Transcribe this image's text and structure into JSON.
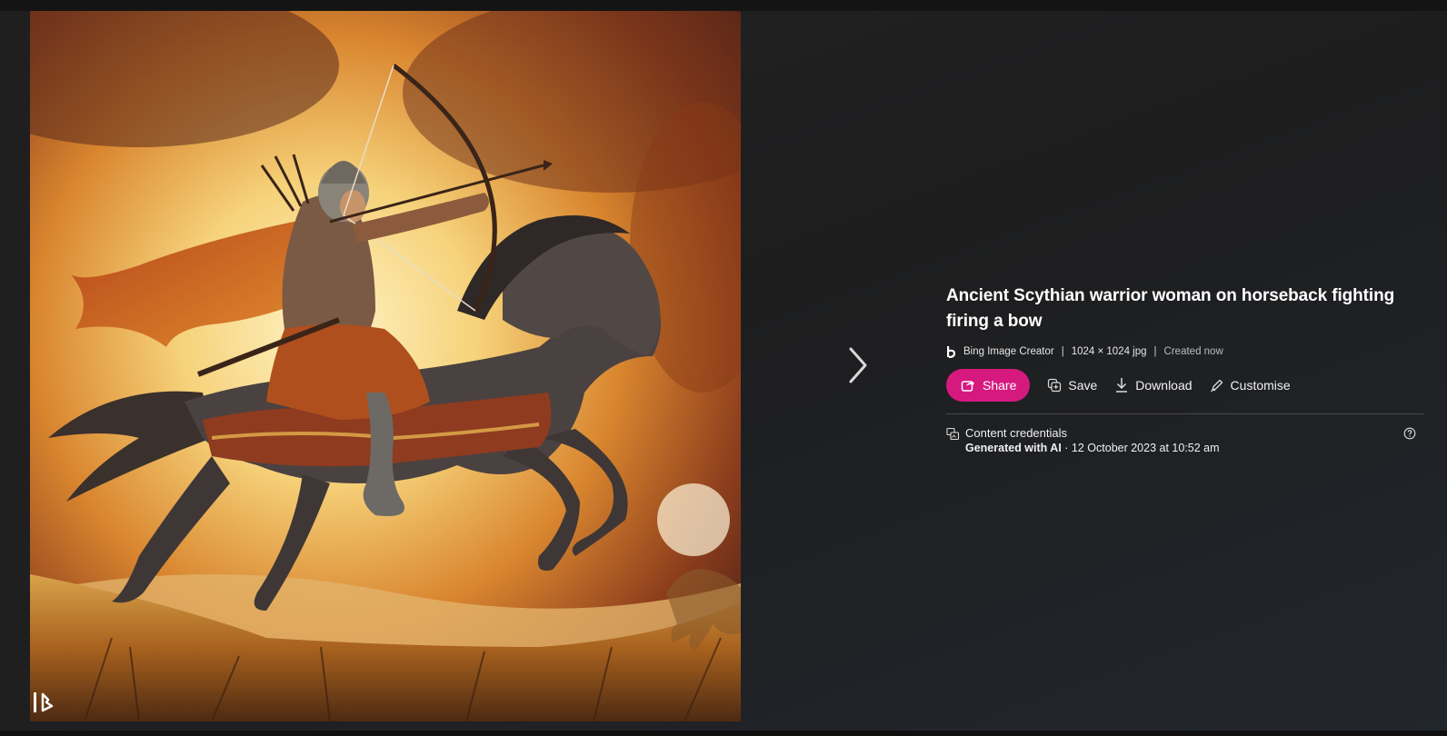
{
  "image": {
    "alt": "Ancient Scythian warrior woman on horseback fighting firing a bow",
    "watermark_icon": "bing-logo-icon"
  },
  "navigation": {
    "next_icon": "chevron-right-icon"
  },
  "details": {
    "title": "Ancient Scythian warrior woman on horseback fighting firing a bow",
    "source": "Bing Image Creator",
    "dimensions": "1024 × 1024 jpg",
    "created": "Created now",
    "separator": "|"
  },
  "actions": {
    "share_label": "Share",
    "save_label": "Save",
    "download_label": "Download",
    "customise_label": "Customise"
  },
  "credentials": {
    "title": "Content credentials",
    "generated_label": "Generated with AI",
    "date_text": " · 12 October 2023 at 10:52 am"
  },
  "colors": {
    "share_button": "#d6197f",
    "background": "#1d1d1e"
  }
}
